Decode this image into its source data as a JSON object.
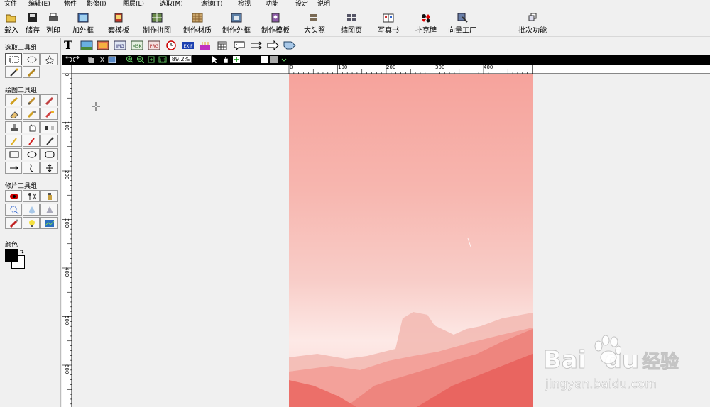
{
  "menu": [
    "文件",
    "编辑(E)",
    "物件",
    "影像(I)",
    "图层(L)",
    "选取(M)",
    "滤镜(T)",
    "检视",
    "功能",
    "设定",
    "说明"
  ],
  "toolbar": [
    "载入",
    "储存",
    "列印",
    "加外框",
    "套模板",
    "制作拼图",
    "制作材质",
    "制作外框",
    "制作模板",
    "大头照",
    "缩图页",
    "写真书",
    "扑克牌",
    "向量工厂",
    "批次功能"
  ],
  "groups": {
    "select": "选取工具组",
    "draw": "绘图工具组",
    "retouch": "修片工具组",
    "color": "颜色"
  },
  "format_icons": [
    "IMG",
    "MSK",
    "PRG",
    "EXIF"
  ],
  "zoom": "89.2%",
  "hruler": [
    "0",
    "100",
    "200",
    "300",
    "400"
  ],
  "vruler": [
    "0",
    "100",
    "200",
    "300",
    "400",
    "500",
    "600"
  ],
  "watermark": {
    "brand": "Bai",
    "brand2": "du",
    "cn": "经验",
    "url": "jingyan.baidu.com"
  },
  "colors": {
    "foreground": "#000000",
    "background": "#ffffff",
    "image_top": "#f6a39c",
    "mountain": "#ee7c76"
  }
}
